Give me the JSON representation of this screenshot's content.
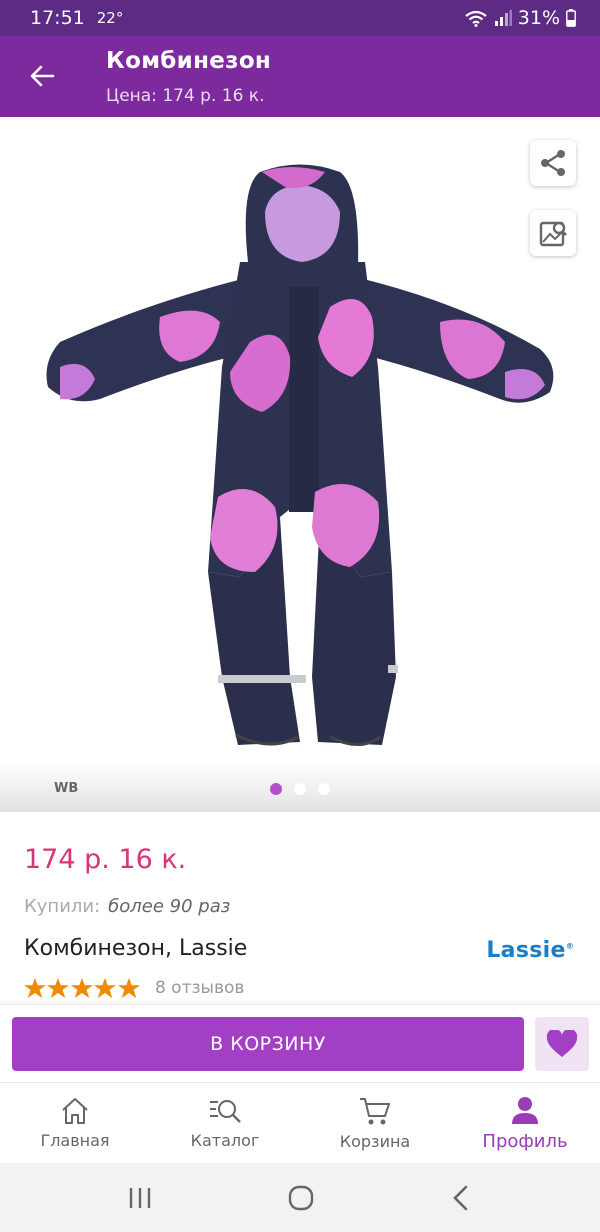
{
  "status_bar": {
    "time": "17:51",
    "temperature": "22°",
    "battery": "31%"
  },
  "app_bar": {
    "title": "Комбинезон",
    "subtitle": "Цена: 174 р. 16 к."
  },
  "gallery": {
    "watermark": "WB",
    "pages": 3,
    "active_page": 1
  },
  "product": {
    "price": "174 р. 16 к.",
    "bought_label": "Купили:",
    "bought_value": "более 90 раз",
    "name": "Комбинезон, Lassie",
    "brand": "Lassie",
    "stars": 5,
    "reviews": "8 отзывов"
  },
  "actions": {
    "cart_button": "В КОРЗИНУ"
  },
  "bottom_nav": {
    "items": [
      {
        "label": "Главная",
        "icon": "home-icon"
      },
      {
        "label": "Каталог",
        "icon": "catalog-search-icon"
      },
      {
        "label": "Корзина",
        "icon": "cart-icon"
      },
      {
        "label": "Профиль",
        "icon": "profile-icon"
      }
    ],
    "active": "Профиль"
  },
  "colors": {
    "status_bar": "#5d2a84",
    "app_bar": "#7d2a9f",
    "accent": "#a33fc4",
    "price": "#d9347a",
    "brand": "#1a7fc9",
    "star": "#f08a00"
  }
}
